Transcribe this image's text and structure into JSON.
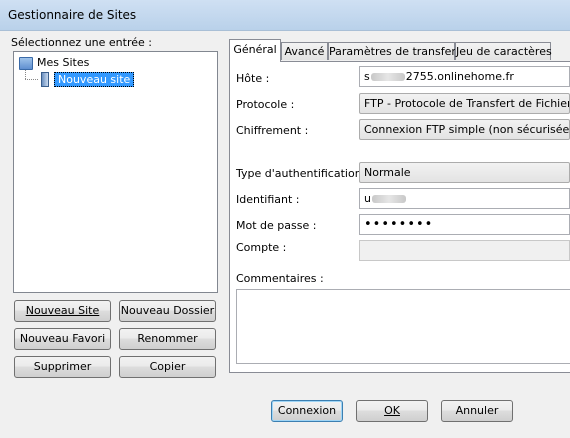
{
  "window": {
    "title": "Gestionnaire de Sites"
  },
  "tree": {
    "label": "Sélectionnez une entrée :",
    "root": "Mes Sites",
    "child": "Nouveau site"
  },
  "left_buttons": {
    "new_site": "Nouveau Site",
    "new_folder": "Nouveau Dossier",
    "new_bookmark": "Nouveau Favori",
    "rename": "Renommer",
    "delete": "Supprimer",
    "copy": "Copier"
  },
  "tabs": [
    "Général",
    "Avancé",
    "Paramètres de transfert",
    "Jeu de caractères"
  ],
  "form": {
    "host_label": "Hôte :",
    "host_prefix": "s",
    "host_suffix": "2755.onlinehome.fr",
    "protocol_label": "Protocole :",
    "protocol_value": "FTP - Protocole de Transfert de Fichiers",
    "encryption_label": "Chiffrement :",
    "encryption_value": "Connexion FTP simple (non sécurisée)",
    "auth_label": "Type d'authentification :",
    "auth_value": "Normale",
    "user_label": "Identifiant :",
    "user_prefix": "u",
    "password_label": "Mot de passe :",
    "password_value": "••••••••",
    "account_label": "Compte :",
    "comments_label": "Commentaires :"
  },
  "bottom_buttons": {
    "connect": "Connexion",
    "ok": "OK",
    "cancel": "Annuler"
  }
}
